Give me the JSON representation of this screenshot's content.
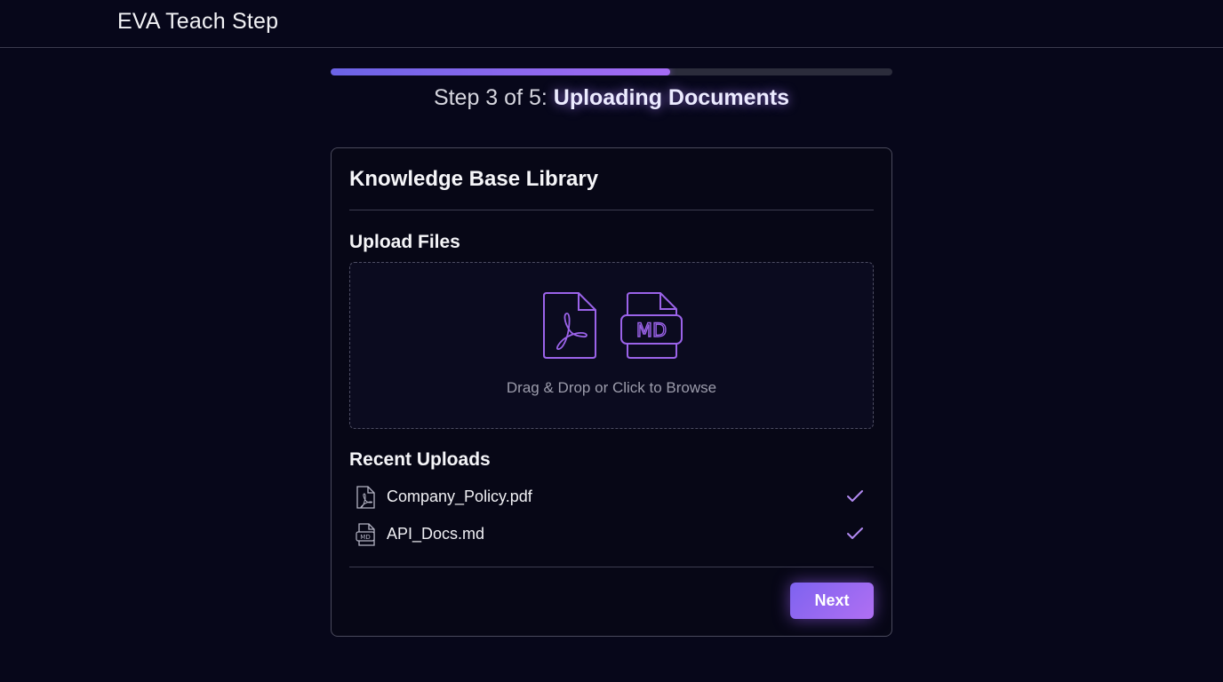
{
  "app": {
    "title": "EVA Teach Step"
  },
  "progress": {
    "fraction": 0.605
  },
  "step": {
    "prefix": "Step 3 of 5:",
    "name": "Uploading Documents"
  },
  "card": {
    "title": "Knowledge Base Library",
    "upload_section_title": "Upload Files",
    "dropzone": {
      "text": "Drag & Drop or Click to Browse",
      "icons": [
        "pdf-file-icon",
        "md-file-icon"
      ]
    },
    "recent_section_title": "Recent Uploads",
    "recent_uploads": [
      {
        "name": "Company_Policy.pdf",
        "icon": "pdf-file-icon",
        "status": "check-icon"
      },
      {
        "name": "API_Docs.md",
        "icon": "md-file-icon",
        "status": "check-icon"
      }
    ],
    "next_label": "Next"
  },
  "colors": {
    "background": "#07071a",
    "accent": "#a56cf4",
    "accent_start": "#6b63e6",
    "icon_stroke": "#9b63e9",
    "check": "#b28af2"
  }
}
